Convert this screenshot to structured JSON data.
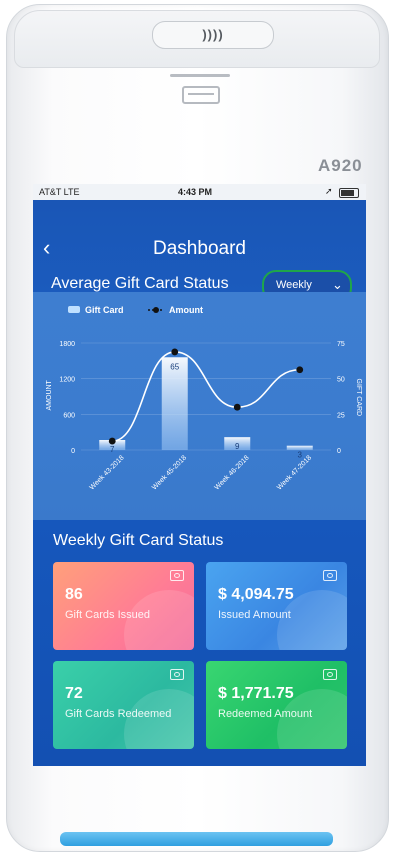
{
  "device": {
    "model": "A920",
    "nfc_label": "))))"
  },
  "statusbar": {
    "carrier": "AT&T  LTE",
    "time": "4:43 PM",
    "location_arrow": "➚"
  },
  "header": {
    "back_icon": "‹",
    "title": "Dashboard",
    "subtitle": "Average Gift Card Status",
    "dropdown": {
      "selected": "Weekly",
      "icon": "⌄"
    }
  },
  "chart_data": {
    "type": "bar",
    "categories": [
      "Week 43-2018",
      "Week 45-2018",
      "Week 46-2018",
      "Week 47-2018"
    ],
    "series": [
      {
        "name": "Gift Card",
        "type": "bar",
        "axis": "right",
        "values": [
          7,
          65,
          9,
          3
        ],
        "color": "#ffffff"
      },
      {
        "name": "Amount",
        "type": "line",
        "axis": "left",
        "values": [
          150,
          1650,
          720,
          1350
        ],
        "color": "#111111"
      }
    ],
    "bar_labels": [
      "7",
      "65",
      "9",
      "3"
    ],
    "left_axis": {
      "label": "AMOUNT",
      "ticks": [
        "1800",
        "1200",
        "600",
        "0"
      ],
      "range": [
        0,
        1800
      ]
    },
    "right_axis": {
      "label": "GIFT CARD",
      "ticks": [
        "75",
        "50",
        "25",
        "0"
      ],
      "range": [
        0,
        75
      ]
    },
    "legend_position": "top-left"
  },
  "status_section": {
    "title": "Weekly Gift Card Status",
    "cards": [
      {
        "value": "86",
        "label": "Gift Cards Issued"
      },
      {
        "value": "$ 4,094.75",
        "label": "Issued Amount"
      },
      {
        "value": "72",
        "label": "Gift Cards Redeemed"
      },
      {
        "value": "$ 1,771.75",
        "label": "Redeemed Amount"
      }
    ]
  }
}
